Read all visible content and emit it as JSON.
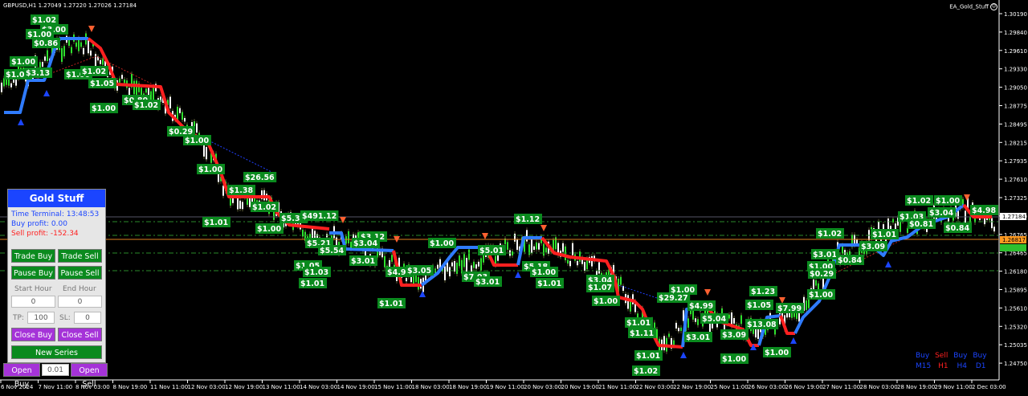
{
  "window": {
    "title": "GBPUSD,H1  1.27049 1.27220 1.27026 1.27184",
    "ea_name": "EA_Gold_Stuff",
    "ea_icon": "smiley-icon"
  },
  "panel": {
    "title": "Gold Stuff",
    "time_terminal": "Time Terminal: 13:48:53",
    "buy_profit": "Buy profit: 0.00",
    "sell_profit": "Sell profit: -152.34",
    "trade_buy": "Trade Buy",
    "trade_sell": "Trade Sell",
    "pause_buy": "Pause Buy",
    "pause_sell": "Pause Sell",
    "start_hour_label": "Start Hour",
    "end_hour_label": "End Hour",
    "start_hour_value": "0",
    "end_hour_value": "0",
    "tp_label": "TP:",
    "tp_value": "100",
    "sl_label": "SL:",
    "sl_value": "0",
    "close_buy": "Close Buy",
    "close_sell": "Close Sell",
    "new_series": "New Series",
    "open_buy": "Open Buy",
    "lot_value": "0.01",
    "open_sell": "Open Sell"
  },
  "price_axis": [
    "1.30190",
    "1.29840",
    "1.29610",
    "1.29330",
    "1.29050",
    "1.28775",
    "1.28495",
    "1.28215",
    "1.27935",
    "1.27610",
    "1.27325",
    "1.27040",
    "1.26765",
    "1.26465",
    "1.26180",
    "1.25895",
    "1.25610",
    "1.25320",
    "1.25035",
    "1.24750"
  ],
  "price_markers": {
    "current": "1.27184",
    "orange": "1.26817",
    "green": "1.26?..."
  },
  "time_axis": [
    "6 Nov 2024",
    "7 Nov 11:00",
    "8 Nov 03:00",
    "8 Nov 19:00",
    "11 Nov 11:00",
    "12 Nov 03:00",
    "12 Nov 19:00",
    "13 Nov 11:00",
    "14 Nov 03:00",
    "14 Nov 19:00",
    "15 Nov 11:00",
    "18 Nov 03:00",
    "18 Nov 19:00",
    "19 Nov 11:00",
    "20 Nov 03:00",
    "20 Nov 19:00",
    "21 Nov 11:00",
    "22 Nov 03:00",
    "22 Nov 19:00",
    "25 Nov 11:00",
    "26 Nov 03:00",
    "26 Nov 19:00",
    "27 Nov 11:00",
    "28 Nov 03:00",
    "28 Nov 19:00",
    "29 Nov 11:00",
    "2 Dec 03:00"
  ],
  "legend": {
    "top": [
      {
        "text": "Buy",
        "color": "#1b45ff"
      },
      {
        "text": "Sell",
        "color": "#ff2020"
      },
      {
        "text": "Buy",
        "color": "#1b45ff"
      },
      {
        "text": "Buy",
        "color": "#1b45ff"
      }
    ],
    "bottom": [
      {
        "text": "M15",
        "color": "#1b45ff"
      },
      {
        "text": "H1",
        "color": "#ff2020"
      },
      {
        "text": "H4",
        "color": "#1b45ff"
      },
      {
        "text": "D1",
        "color": "#1b45ff"
      }
    ]
  },
  "profit_labels": [
    {
      "text": "$1.02"
    },
    {
      "text": "$3.00"
    },
    {
      "text": "$1.00"
    },
    {
      "text": "$0.86"
    },
    {
      "text": "$1.00"
    },
    {
      "text": "$1.00"
    },
    {
      "text": "$3.13"
    },
    {
      "text": "$1.00"
    },
    {
      "text": "$1.02"
    },
    {
      "text": "$1.05"
    },
    {
      "text": "$1.00"
    },
    {
      "text": "$0.80"
    },
    {
      "text": "$1.02"
    },
    {
      "text": "$0.29"
    },
    {
      "text": "$1.00"
    },
    {
      "text": "$1.00"
    },
    {
      "text": "$26.56"
    },
    {
      "text": "$1.38"
    },
    {
      "text": "$1.02"
    },
    {
      "text": "$1.01"
    },
    {
      "text": "$5.34"
    },
    {
      "text": "$491.12"
    },
    {
      "text": "$1.00"
    },
    {
      "text": "$5.21"
    },
    {
      "text": "$3.12"
    },
    {
      "text": "$3.04"
    },
    {
      "text": "$5.54"
    },
    {
      "text": "$1.05"
    },
    {
      "text": "$1.03"
    },
    {
      "text": "$1.01"
    },
    {
      "text": "$3.01"
    },
    {
      "text": "$4.99"
    },
    {
      "text": "$3.05"
    },
    {
      "text": "$1.00"
    },
    {
      "text": "$1.01"
    },
    {
      "text": "$1.12"
    },
    {
      "text": "$5.01"
    },
    {
      "text": "$7.03"
    },
    {
      "text": "$3.01"
    },
    {
      "text": "$5.18"
    },
    {
      "text": "$1.00"
    },
    {
      "text": "$1.01"
    },
    {
      "text": "$3.04"
    },
    {
      "text": "$1.07"
    },
    {
      "text": "$1.00"
    },
    {
      "text": "$29.27"
    },
    {
      "text": "$1.00"
    },
    {
      "text": "$4.99"
    },
    {
      "text": "$5.04"
    },
    {
      "text": "$1.01"
    },
    {
      "text": "$1.11"
    },
    {
      "text": "$1.01"
    },
    {
      "text": "$1.02"
    },
    {
      "text": "$3.01"
    },
    {
      "text": "$3.09"
    },
    {
      "text": "$1.00"
    },
    {
      "text": "$1.23"
    },
    {
      "text": "$1.05"
    },
    {
      "text": "$13.08"
    },
    {
      "text": "$1.00"
    },
    {
      "text": "$7.99"
    },
    {
      "text": "$1.00"
    },
    {
      "text": "$1.02"
    },
    {
      "text": "$3.01"
    },
    {
      "text": "$1.00"
    },
    {
      "text": "$0.29"
    },
    {
      "text": "$0.84"
    },
    {
      "text": "$3.09"
    },
    {
      "text": "$1.01"
    },
    {
      "text": "$1.02"
    },
    {
      "text": "$1.00"
    },
    {
      "text": "$1.03"
    },
    {
      "text": "$3.04"
    },
    {
      "text": "$0.81"
    },
    {
      "text": "$0.84"
    },
    {
      "text": "$4.98"
    }
  ]
}
